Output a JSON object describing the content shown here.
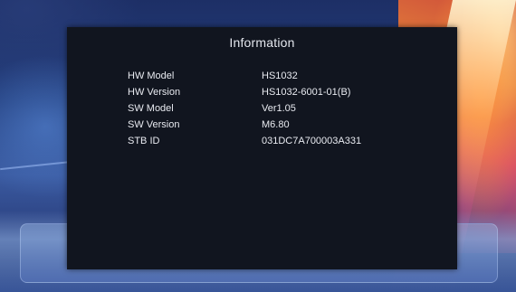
{
  "panel": {
    "title": "Information",
    "rows": [
      {
        "label": "HW Model",
        "value": "HS1032"
      },
      {
        "label": "HW Version",
        "value": "HS1032-6001-01(B)"
      },
      {
        "label": "SW Model",
        "value": "Ver1.05"
      },
      {
        "label": "SW Version",
        "value": "M6.80"
      },
      {
        "label": "STB ID",
        "value": "031DC7A700003A331"
      }
    ]
  },
  "colors": {
    "panel_bg": "#11151f",
    "text": "#e8eaf0",
    "backdrop_blue": "#24407f",
    "backdrop_warm": "#e07a3a"
  }
}
